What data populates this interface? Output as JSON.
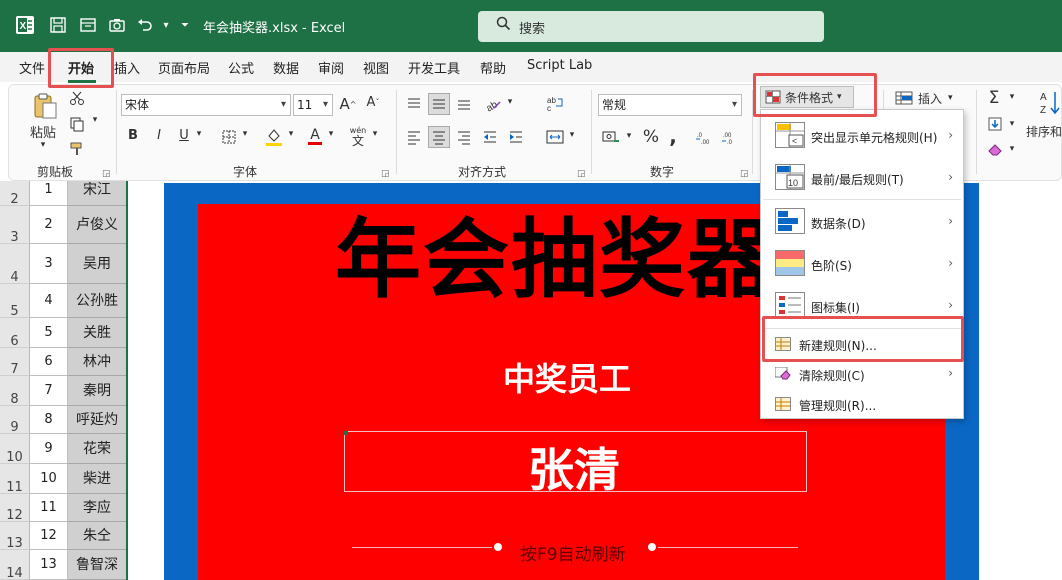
{
  "window": {
    "title": "年会抽奖器.xlsx  -  Excel",
    "search_label": "搜索"
  },
  "menu": {
    "tabs": [
      "文件",
      "开始",
      "插入",
      "页面布局",
      "公式",
      "数据",
      "审阅",
      "视图",
      "开发工具",
      "帮助",
      "Script Lab"
    ]
  },
  "ribbon": {
    "paste_label": "粘贴",
    "clipboard_label": "剪贴板",
    "font_group_label": "字体",
    "align_group_label": "对齐方式",
    "number_group_label": "数字",
    "font_name": "宋体",
    "font_size": "11",
    "number_format": "常规",
    "cond_format_label": "条件格式",
    "insert_label": "插入",
    "sort_label": "排序和",
    "wen_label": "wén",
    "wen_char": "文"
  },
  "dropdown": {
    "items": [
      {
        "label": "突出显示单元格规则(H)"
      },
      {
        "label": "最前/最后规则(T)"
      },
      {
        "label": "数据条(D)"
      },
      {
        "label": "色阶(S)"
      },
      {
        "label": "图标集(I)"
      },
      {
        "label": "新建规则(N)..."
      },
      {
        "label": "清除规则(C)"
      },
      {
        "label": "管理规则(R)..."
      }
    ],
    "icon_top10_text": "10"
  },
  "sheet": {
    "rows": [
      {
        "row": "2",
        "num": "1",
        "name": "宋江"
      },
      {
        "row": "3",
        "num": "2",
        "name": "卢俊义"
      },
      {
        "row": "4",
        "num": "3",
        "name": "吴用"
      },
      {
        "row": "5",
        "num": "4",
        "name": "公孙胜"
      },
      {
        "row": "6",
        "num": "5",
        "name": "关胜"
      },
      {
        "row": "7",
        "num": "6",
        "name": "林冲"
      },
      {
        "row": "8",
        "num": "7",
        "name": "秦明"
      },
      {
        "row": "9",
        "num": "8",
        "name": "呼延灼"
      },
      {
        "row": "10",
        "num": "9",
        "name": "花荣"
      },
      {
        "row": "11",
        "num": "10",
        "name": "柴进"
      },
      {
        "row": "12",
        "num": "11",
        "name": "李应"
      },
      {
        "row": "13",
        "num": "12",
        "name": "朱仝"
      },
      {
        "row": "14",
        "num": "13",
        "name": "鲁智深"
      }
    ]
  },
  "lottery": {
    "title": "年会抽奖器",
    "subtitle": "中奖员工",
    "winner": "张清",
    "hint": "按F9自动刷新"
  },
  "colors": {
    "excel_green": "#1e7145",
    "panel_blue": "#0a67c4",
    "panel_red": "#ff0000",
    "highlight": "#e55050"
  }
}
